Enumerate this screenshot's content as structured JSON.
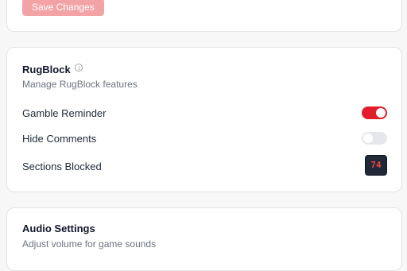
{
  "top_card": {
    "save_label": "Save Changes"
  },
  "rugblock": {
    "title": "RugBlock",
    "description": "Manage RugBlock features",
    "gamble_reminder": {
      "label": "Gamble Reminder",
      "enabled": true
    },
    "hide_comments": {
      "label": "Hide Comments",
      "enabled": false
    },
    "sections_blocked": {
      "label": "Sections Blocked",
      "count": "74"
    }
  },
  "audio": {
    "title": "Audio Settings",
    "description": "Adjust volume for game sounds"
  },
  "colors": {
    "accent": "#e11d2a",
    "save_button_disabled": "#f3a3a6",
    "counter_bg": "#1f2937",
    "counter_text": "#ef4444"
  }
}
